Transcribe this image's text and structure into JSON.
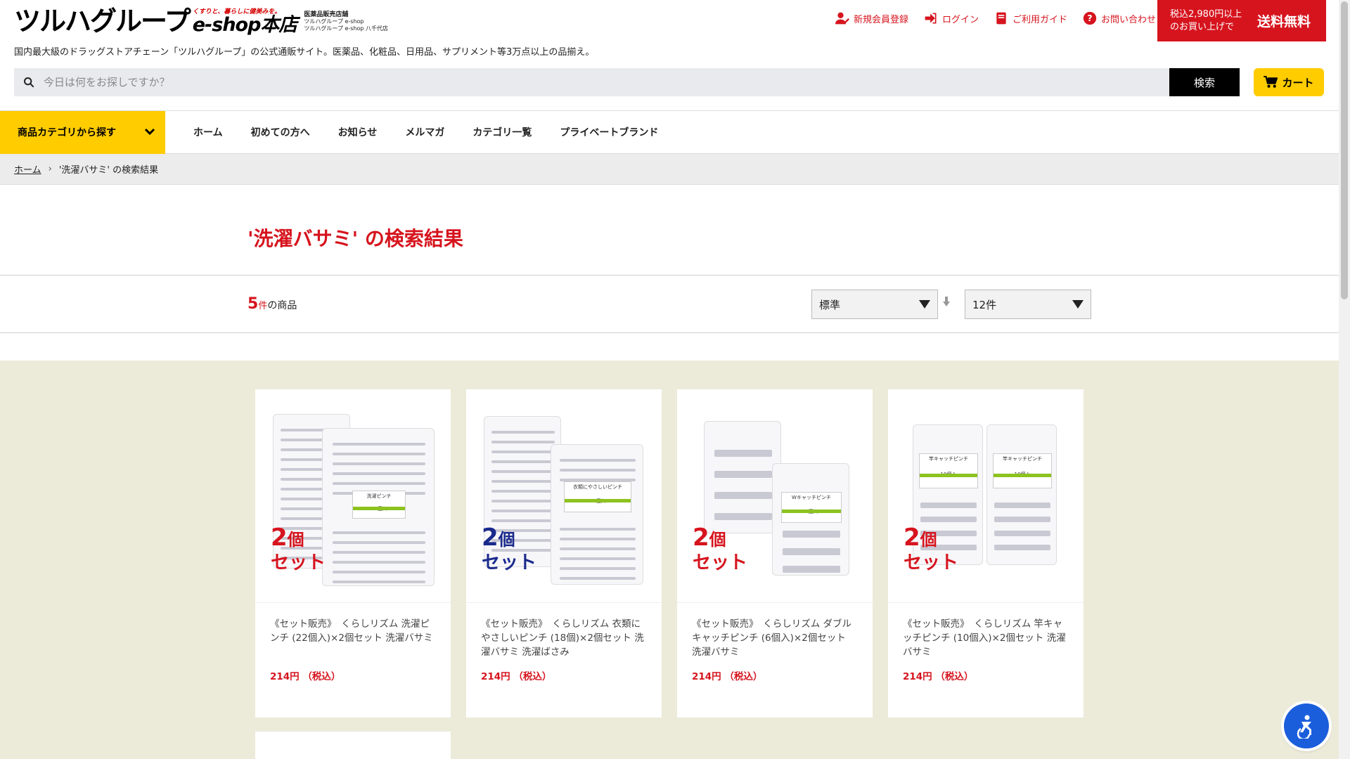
{
  "header": {
    "logo_main": "ツルハグループ",
    "logo_tag": "くすりと、暮らしに健美みを。",
    "logo_shop": "e-shop本店",
    "logo_sub_title": "医薬品販売店舗",
    "logo_sub_line1": "ツルハグループ e-shop",
    "logo_sub_line2": "ツルハグループ e-shop 八千代店",
    "tagline": "国内最大級のドラッグストアチェーン「ツルハグループ」の公式通販サイト。医薬品、化粧品、日用品、サプリメント等3万点以上の品揃え。",
    "links": [
      {
        "label": "新規会員登録",
        "icon": "user-plus-icon"
      },
      {
        "label": "ログイン",
        "icon": "login-icon"
      },
      {
        "label": "ご利用ガイド",
        "icon": "guide-book-icon"
      },
      {
        "label": "お問い合わせ",
        "icon": "help-circle-icon"
      }
    ],
    "freeship_small": "税込2,980円以上のお買い上げで",
    "freeship_big": "送料無料",
    "accent_color": "#d6141e",
    "yellow_color": "#ffcc00"
  },
  "search": {
    "placeholder": "今日は何をお探しですか？",
    "value": "",
    "button_label": "検索",
    "cart_label": "カート"
  },
  "nav": {
    "category_label": "商品カテゴリから探す",
    "items": [
      "ホーム",
      "初めての方へ",
      "お知らせ",
      "メルマガ",
      "カテゴリ一覧",
      "プライベートブランド"
    ]
  },
  "breadcrumb": {
    "home": "ホーム",
    "current": "'洗濯バサミ' の検索結果"
  },
  "results": {
    "title": "'洗濯バサミ' の検索結果",
    "count": "5",
    "count_unit": "件",
    "count_label": "の商品",
    "sort_value": "標準",
    "per_page_value": "12件"
  },
  "products": [
    {
      "name": "《セット販売》　くらしリズム 洗濯ピンチ (22個入)×2個セット 洗濯バサミ",
      "price": "214円 （税込）",
      "badge_num": "2",
      "badge_unit": "個",
      "badge_word": "セット",
      "badge_color": "#d6141e",
      "pack_label": "洗濯ピンチ",
      "pack_count": "22個入"
    },
    {
      "name": "《セット販売》　くらしリズム 衣類にやさしいピンチ (18個)×2個セット 洗濯バサミ 洗濯ばさみ",
      "price": "214円 （税込）",
      "badge_num": "2",
      "badge_unit": "個",
      "badge_word": "セット",
      "badge_color": "#1a2a8c",
      "pack_label": "衣類にやさしいピンチ",
      "pack_count": "18個入"
    },
    {
      "name": "《セット販売》　くらしリズム ダブルキャッチピンチ (6個入)×2個セット 洗濯バサミ",
      "price": "214円 （税込）",
      "badge_num": "2",
      "badge_unit": "個",
      "badge_word": "セット",
      "badge_color": "#d6141e",
      "pack_label": "Wキャッチピンチ",
      "pack_count": "6個入"
    },
    {
      "name": "《セット販売》　くらしリズム 竿キャッチピンチ (10個入)×2個セット 洗濯バサミ",
      "price": "214円 （税込）",
      "badge_num": "2",
      "badge_unit": "個",
      "badge_word": "セット",
      "badge_color": "#d6141e",
      "pack_label": "竿キャッチピンチ",
      "pack_count": "10個入"
    }
  ]
}
